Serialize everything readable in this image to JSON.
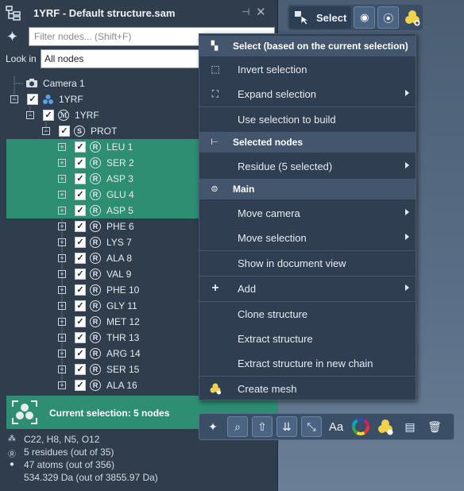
{
  "window": {
    "title": "1YRF - Default structure.sam"
  },
  "filter": {
    "placeholder": "Filter nodes... (Shift+F)",
    "value": ""
  },
  "look_in": {
    "label": "Look in",
    "value": "All nodes"
  },
  "tree": {
    "camera": "Camera 1",
    "structure": "1YRF",
    "model": "1YRF",
    "chain": "PROT",
    "residues": [
      {
        "label": "LEU 1",
        "selected": true
      },
      {
        "label": "SER 2",
        "selected": true
      },
      {
        "label": "ASP 3",
        "selected": true
      },
      {
        "label": "GLU 4",
        "selected": true
      },
      {
        "label": "ASP 5",
        "selected": true
      },
      {
        "label": "PHE 6",
        "selected": false
      },
      {
        "label": "LYS 7",
        "selected": false
      },
      {
        "label": "ALA 8",
        "selected": false
      },
      {
        "label": "VAL 9",
        "selected": false
      },
      {
        "label": "PHE 10",
        "selected": false
      },
      {
        "label": "GLY 11",
        "selected": false
      },
      {
        "label": "MET 12",
        "selected": false
      },
      {
        "label": "THR 13",
        "selected": false
      },
      {
        "label": "ARG 14",
        "selected": false
      },
      {
        "label": "SER 15",
        "selected": false
      },
      {
        "label": "ALA 16",
        "selected": false
      }
    ]
  },
  "current_selection": {
    "label": "Current selection: 5 nodes"
  },
  "stats": {
    "formula": "C22, H8, N5, O12",
    "residues": "5 residues (out of 35)",
    "atoms": "47 atoms (out of 356)",
    "mass": "534.329 Da (out of 3855.97 Da)"
  },
  "top_toolbar": {
    "select_label": "Select"
  },
  "menu": {
    "header_select": "Select (based on the current selection)",
    "invert": "Invert selection",
    "expand": "Expand selection",
    "use_to_build": "Use selection to build",
    "header_selected_nodes": "Selected nodes",
    "residue": "Residue (5 selected)",
    "header_main": "Main",
    "move_camera": "Move camera",
    "move_selection": "Move selection",
    "show_in_doc": "Show in document view",
    "add": "Add",
    "clone": "Clone structure",
    "extract": "Extract structure",
    "extract_new_chain": "Extract structure in new chain",
    "create_mesh": "Create mesh"
  },
  "bottom_toolbar": {
    "text_tool_label": "Aa"
  },
  "colors": {
    "highlight": "#2e8e72",
    "panel": "#2f3d4d",
    "menu": "#2f3e50"
  }
}
